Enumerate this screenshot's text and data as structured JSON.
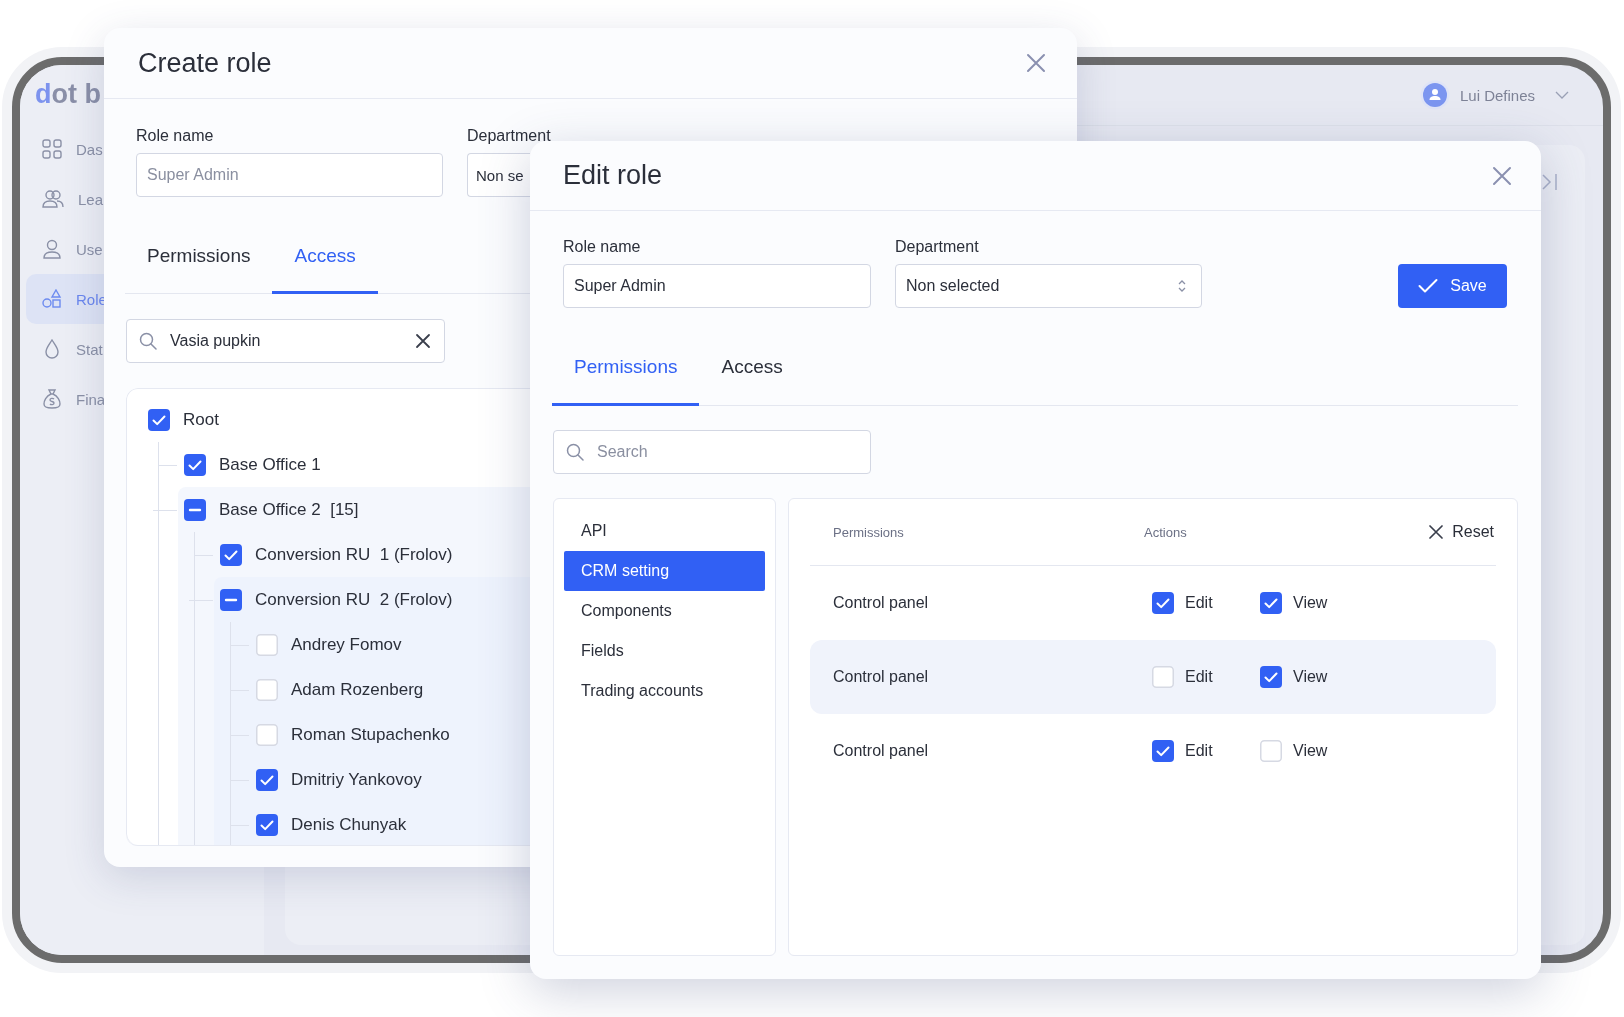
{
  "app": {
    "logo": "dot b",
    "sidebar": {
      "items": [
        {
          "label": "Das",
          "selected": false
        },
        {
          "label": "Lea",
          "selected": false
        },
        {
          "label": "Use",
          "selected": false
        },
        {
          "label": "Role",
          "selected": true
        },
        {
          "label": "Stat",
          "selected": false
        },
        {
          "label": "Fina",
          "selected": false
        }
      ]
    },
    "user": {
      "name": "Lui Defines"
    }
  },
  "create_role": {
    "title": "Create role",
    "role_name": {
      "label": "Role name",
      "placeholder": "Super Admin"
    },
    "department": {
      "label": "Department",
      "value": "Non se"
    },
    "tabs": [
      {
        "label": "Permissions",
        "selected": false
      },
      {
        "label": "Access",
        "selected": true
      }
    ],
    "search": {
      "value": "Vasia pupkin"
    },
    "tree": [
      {
        "label": "Root",
        "checked": true,
        "indeterminate": false,
        "children": [
          {
            "label": "Base Office 1",
            "checked": true,
            "indeterminate": false
          },
          {
            "label": "Base Office 2  [15]",
            "checked": true,
            "indeterminate": true,
            "children": [
              {
                "label": "Conversion RU  1 (Frolov)",
                "checked": true,
                "indeterminate": false
              },
              {
                "label": "Conversion RU  2 (Frolov)",
                "checked": true,
                "indeterminate": true,
                "children": [
                  {
                    "label": "Andrey Fomov",
                    "checked": false,
                    "indeterminate": false
                  },
                  {
                    "label": "Adam Rozenberg",
                    "checked": false,
                    "indeterminate": false
                  },
                  {
                    "label": "Roman Stupachenko",
                    "checked": false,
                    "indeterminate": false
                  },
                  {
                    "label": "Dmitriy Yankovoy",
                    "checked": true,
                    "indeterminate": false
                  },
                  {
                    "label": "Denis Chunyak",
                    "checked": true,
                    "indeterminate": false
                  }
                ]
              }
            ]
          }
        ]
      }
    ]
  },
  "edit_role": {
    "title": "Edit role",
    "role_name": {
      "label": "Role name",
      "value": "Super Admin"
    },
    "department": {
      "label": "Department",
      "value": "Non selected"
    },
    "save": "Save",
    "tabs": [
      {
        "label": "Permissions",
        "selected": true
      },
      {
        "label": "Access",
        "selected": false
      }
    ],
    "search": {
      "placeholder": "Search"
    },
    "categories": [
      {
        "label": "API",
        "selected": false
      },
      {
        "label": "CRM setting",
        "selected": true
      },
      {
        "label": "Components",
        "selected": false
      },
      {
        "label": "Fields",
        "selected": false
      },
      {
        "label": "Trading accounts",
        "selected": false
      }
    ],
    "table": {
      "columns": [
        "Permissions",
        "Actions"
      ],
      "reset": "Reset",
      "rows": [
        {
          "name": "Control panel",
          "highlighted": false,
          "actions": [
            {
              "label": "Edit",
              "checked": true
            },
            {
              "label": "View",
              "checked": true
            }
          ]
        },
        {
          "name": "Control panel",
          "highlighted": true,
          "actions": [
            {
              "label": "Edit",
              "checked": false
            },
            {
              "label": "View",
              "checked": true
            }
          ]
        },
        {
          "name": "Control panel",
          "highlighted": false,
          "actions": [
            {
              "label": "Edit",
              "checked": true
            },
            {
              "label": "View",
              "checked": false
            }
          ]
        }
      ]
    }
  }
}
